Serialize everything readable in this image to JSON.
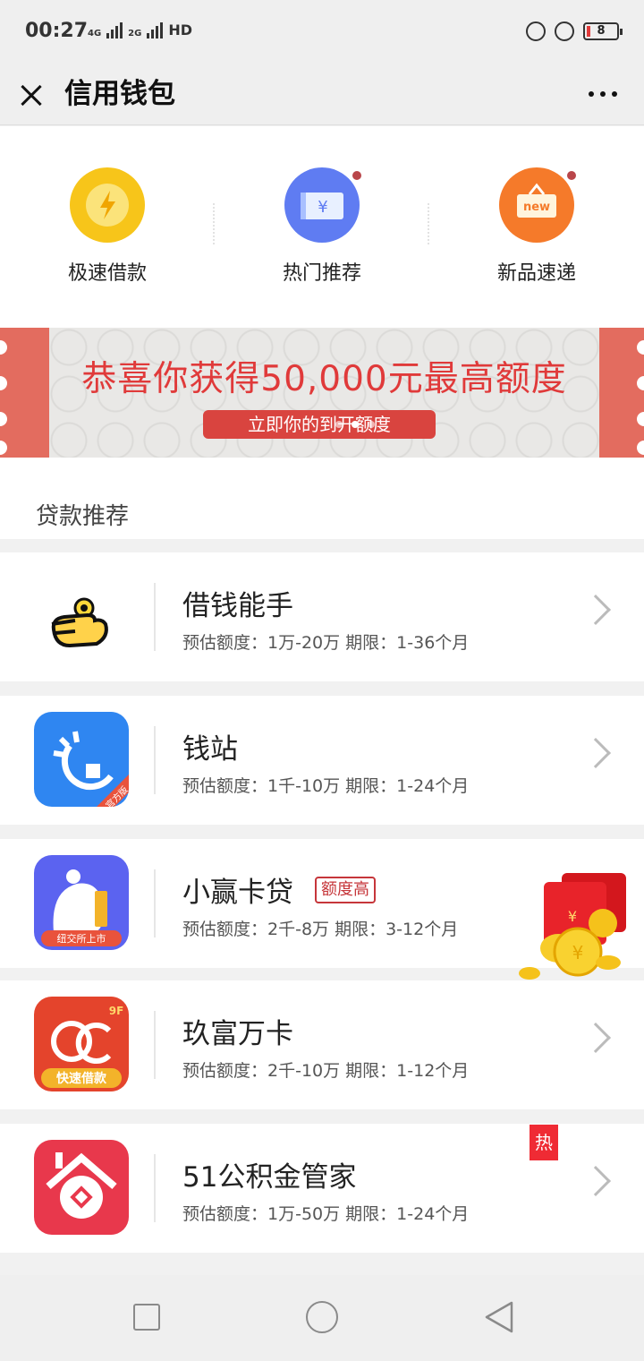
{
  "status_bar": {
    "time": "00:27",
    "net1": "4G",
    "net2": "2G",
    "hd": "HD",
    "battery": "8",
    "battery_low_color": "#e23b3b"
  },
  "title_bar": {
    "title": "信用钱包",
    "close_icon": "close-icon",
    "more_icon": "more-icon"
  },
  "quick_entries": [
    {
      "label": "极速借款",
      "icon": "lightning-icon",
      "color": "#f7c51a",
      "badge": false
    },
    {
      "label": "热门推荐",
      "icon": "money-ticket-icon",
      "color": "#5f7cf2",
      "badge": true
    },
    {
      "label": "新品速递",
      "icon": "new-sign-icon",
      "color": "#f57a2a",
      "badge": true
    }
  ],
  "banner": {
    "headline": "恭喜你获得50,000元最高额度",
    "cta": "立即你的到开额度",
    "accent": "#e03a3a"
  },
  "section": {
    "title": "贷款推荐"
  },
  "loans": [
    {
      "name": "借钱能手",
      "desc": "预估额度：1万-20万  期限：1-36个月"
    },
    {
      "name": "钱站",
      "desc": "预估额度：1千-10万  期限：1-24个月",
      "logo_badge": "官方版"
    },
    {
      "name": "小赢卡贷",
      "desc": "预估额度：2千-8万  期限：3-12个月",
      "tag": "额度高",
      "logo_badge": "纽交所上市"
    },
    {
      "name": "玖富万卡",
      "desc": "预估额度：2千-10万  期限：1-12个月",
      "logo_badge": "快速借款",
      "logo_corner": "9F"
    },
    {
      "name": "51公积金管家",
      "desc": "预估额度：1万-50万  期限：1-24个月",
      "hot": "热"
    }
  ],
  "red_packet": {
    "symbol": "¥"
  }
}
